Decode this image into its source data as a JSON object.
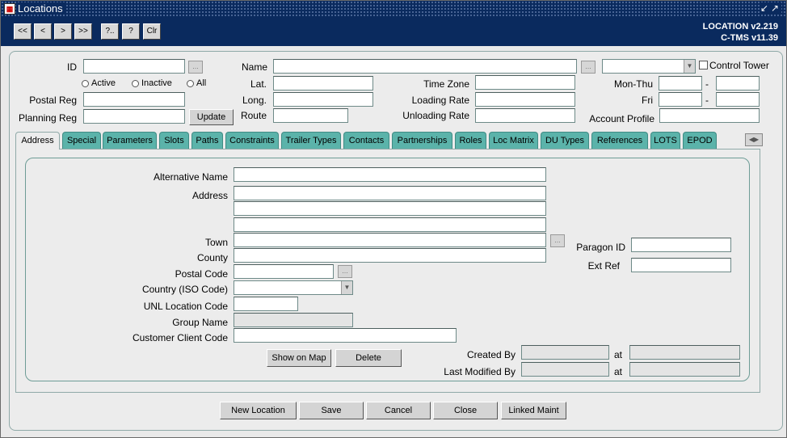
{
  "window": {
    "title": "Locations",
    "title_buttons": "↙↗"
  },
  "toolbar": {
    "buttons": [
      "<<",
      "<",
      ">",
      ">>",
      "?..",
      "?",
      "Clr"
    ],
    "version_location": "LOCATION v2.219",
    "version_ctms": "C-TMS v11.39"
  },
  "header": {
    "id_label": "ID",
    "id_value": "",
    "name_label": "Name",
    "name_value": "",
    "control_tower_label": "Control Tower",
    "radio_active": "Active",
    "radio_inactive": "Inactive",
    "radio_all": "All",
    "lat_label": "Lat.",
    "long_label": "Long.",
    "route_label": "Route",
    "time_zone_label": "Time Zone",
    "loading_rate_label": "Loading Rate",
    "unloading_rate_label": "Unloading Rate",
    "mon_thu_label": "Mon-Thu",
    "fri_label": "Fri",
    "dash": "-",
    "account_profile_label": "Account Profile",
    "postal_reg_label": "Postal Reg",
    "planning_reg_label": "Planning Reg",
    "update_button": "Update"
  },
  "tabs": [
    "Address",
    "Special",
    "Parameters",
    "Slots",
    "Paths",
    "Constraints",
    "Trailer Types",
    "Contacts",
    "Partnerships",
    "Roles",
    "Loc Matrix",
    "DU Types",
    "References",
    "LOTS",
    "EPOD"
  ],
  "address": {
    "alternative_name_label": "Alternative Name",
    "address_label": "Address",
    "town_label": "Town",
    "county_label": "County",
    "postal_code_label": "Postal Code",
    "country_label": "Country (ISO Code)",
    "unl_label": "UNL Location Code",
    "group_name_label": "Group Name",
    "customer_client_code_label": "Customer Client Code",
    "paragon_id_label": "Paragon ID",
    "ext_ref_label": "Ext Ref",
    "show_on_map_button": "Show on Map",
    "delete_button": "Delete",
    "created_by_label": "Created By",
    "last_modified_by_label": "Last Modified By",
    "at_label": "at"
  },
  "footer": {
    "new_location": "New Location",
    "save": "Save",
    "cancel": "Cancel",
    "close": "Close",
    "linked_maint": "Linked Maint"
  },
  "colors": {
    "titlebar": "#0a2a5e",
    "tab": "#5bb3aa",
    "panel_border": "#8fa9a8"
  }
}
